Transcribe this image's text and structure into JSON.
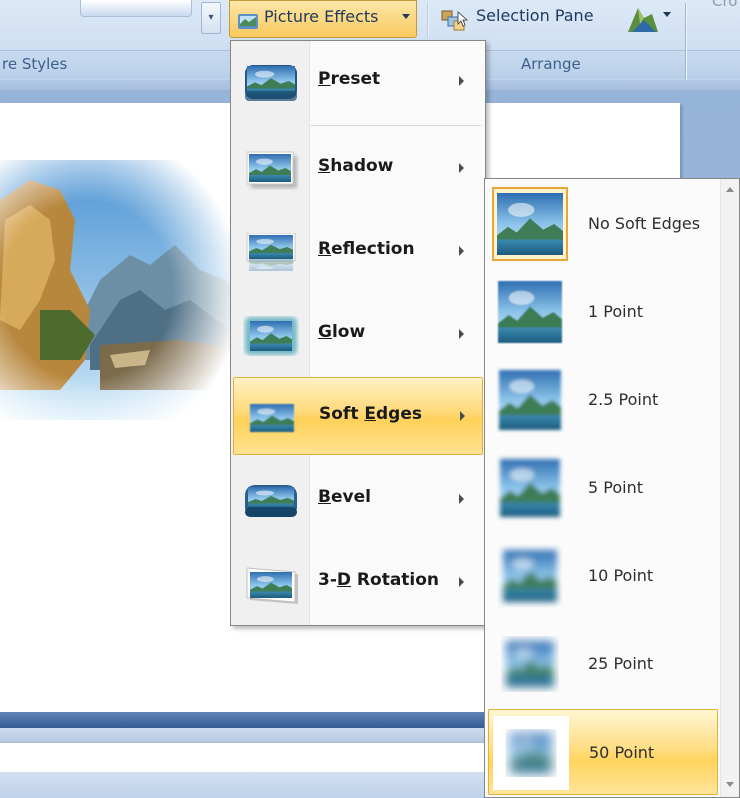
{
  "ribbon": {
    "picture_effects_label": "Picture Effects",
    "selection_pane_label": "Selection Pane",
    "crop_partial_label": "Cro",
    "groups": {
      "picture_styles_label": "re Styles",
      "arrange_label": "Arrange"
    }
  },
  "menu": {
    "items": [
      {
        "pre": "",
        "key": "P",
        "post": "reset",
        "icon": "preset-icon"
      },
      {
        "pre": "",
        "key": "S",
        "post": "hadow",
        "icon": "shadow-icon"
      },
      {
        "pre": "",
        "key": "R",
        "post": "eflection",
        "icon": "reflection-icon"
      },
      {
        "pre": "",
        "key": "G",
        "post": "low",
        "icon": "glow-icon"
      },
      {
        "pre": "Soft ",
        "key": "E",
        "post": "dges",
        "icon": "soft-edges-icon",
        "highlighted": true
      },
      {
        "pre": "",
        "key": "B",
        "post": "evel",
        "icon": "bevel-icon"
      },
      {
        "pre": "3-",
        "key": "D",
        "post": " Rotation",
        "icon": "3d-rotation-icon"
      }
    ]
  },
  "submenu": {
    "items": [
      {
        "label": "No Soft Edges",
        "selected": true
      },
      {
        "label": "1 Point"
      },
      {
        "label": "2.5 Point"
      },
      {
        "label": "5 Point"
      },
      {
        "label": "10 Point"
      },
      {
        "label": "25 Point"
      },
      {
        "label": "50 Point",
        "highlighted": true
      }
    ]
  },
  "colors": {
    "highlight": "#ffd978",
    "highlight_border": "#e2b13a",
    "ribbon": "#cfdff2",
    "text_blue": "#1e395b"
  }
}
